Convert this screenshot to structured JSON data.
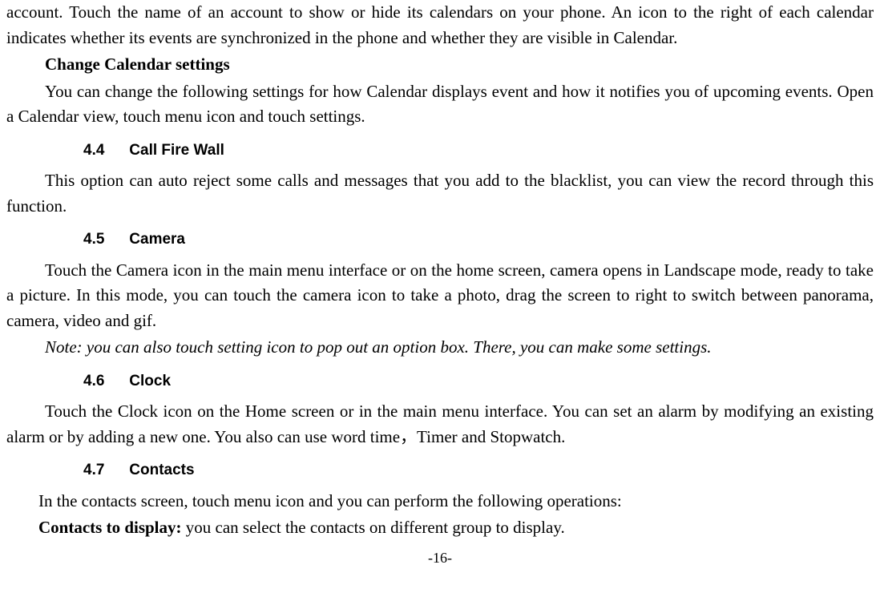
{
  "p1": "account. Touch the name of an account to show or hide its calendars on your phone. An icon to the right of each calendar indicates whether its events are synchronized in the phone and whether they are visible in Calendar.",
  "h_change": "Change Calendar settings",
  "p2": "You can change the following settings for how Calendar displays event and how it notifies you of upcoming events. Open a Calendar view, touch menu icon and touch settings.",
  "s44_num": "4.4",
  "s44_title": "Call Fire Wall",
  "p3": "This option can auto reject some calls and messages that you add to the blacklist, you can view the record through this function.",
  "s45_num": "4.5",
  "s45_title": "Camera",
  "p4": "Touch the Camera icon in the main menu interface or on the home screen, camera opens in Landscape mode, ready to take a picture. In this mode, you can touch the camera icon to take a photo, drag the screen to right to switch between panorama, camera, video and gif.",
  "p5": "Note: you can also touch setting icon to pop out an option box. There, you can make some settings.",
  "s46_num": "4.6",
  "s46_title": "Clock",
  "p6": "Touch the Clock icon on the Home screen or in the main menu interface. You can set an alarm by modifying an existing alarm or by adding a new one. You also can use word time，Timer and Stopwatch.",
  "s47_num": "4.7",
  "s47_title": "Contacts",
  "p7": "In the contacts screen, touch menu icon and you can perform the following operations:",
  "p8_bold": "Contacts to display:",
  "p8_rest": " you can select the contacts on different group to display.",
  "footer": "-16-"
}
